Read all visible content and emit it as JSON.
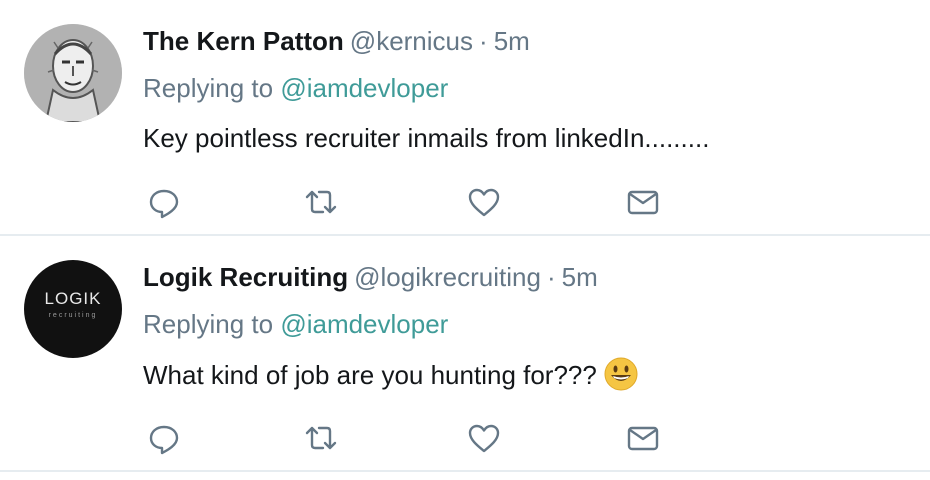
{
  "tweets": [
    {
      "name": "The Kern Patton",
      "handle": "@kernicus",
      "separator": "·",
      "time": "5m",
      "replying_prefix": "Replying to",
      "replying_to": "@iamdevloper",
      "text": "Key pointless recruiter inmails from linkedIn.........",
      "avatar": "sketch-portrait-avatar"
    },
    {
      "name": "Logik Recruiting",
      "handle": "@logikrecruiting",
      "separator": "·",
      "time": "5m",
      "replying_prefix": "Replying to",
      "replying_to": "@iamdevloper",
      "text": "What kind of job are you hunting for???",
      "emoji": "grinning-face-emoji",
      "avatar": "logik-logo-avatar",
      "avatar_logo_text": "LOGIK",
      "avatar_logo_sub": "recruiting"
    }
  ],
  "actions": [
    "reply-icon",
    "retweet-icon",
    "like-icon",
    "direct-message-icon"
  ],
  "colors": {
    "name": "#14171a",
    "meta": "#657786",
    "mention": "#3f9b98",
    "icon": "#657786",
    "divider": "#e6ecf0"
  }
}
